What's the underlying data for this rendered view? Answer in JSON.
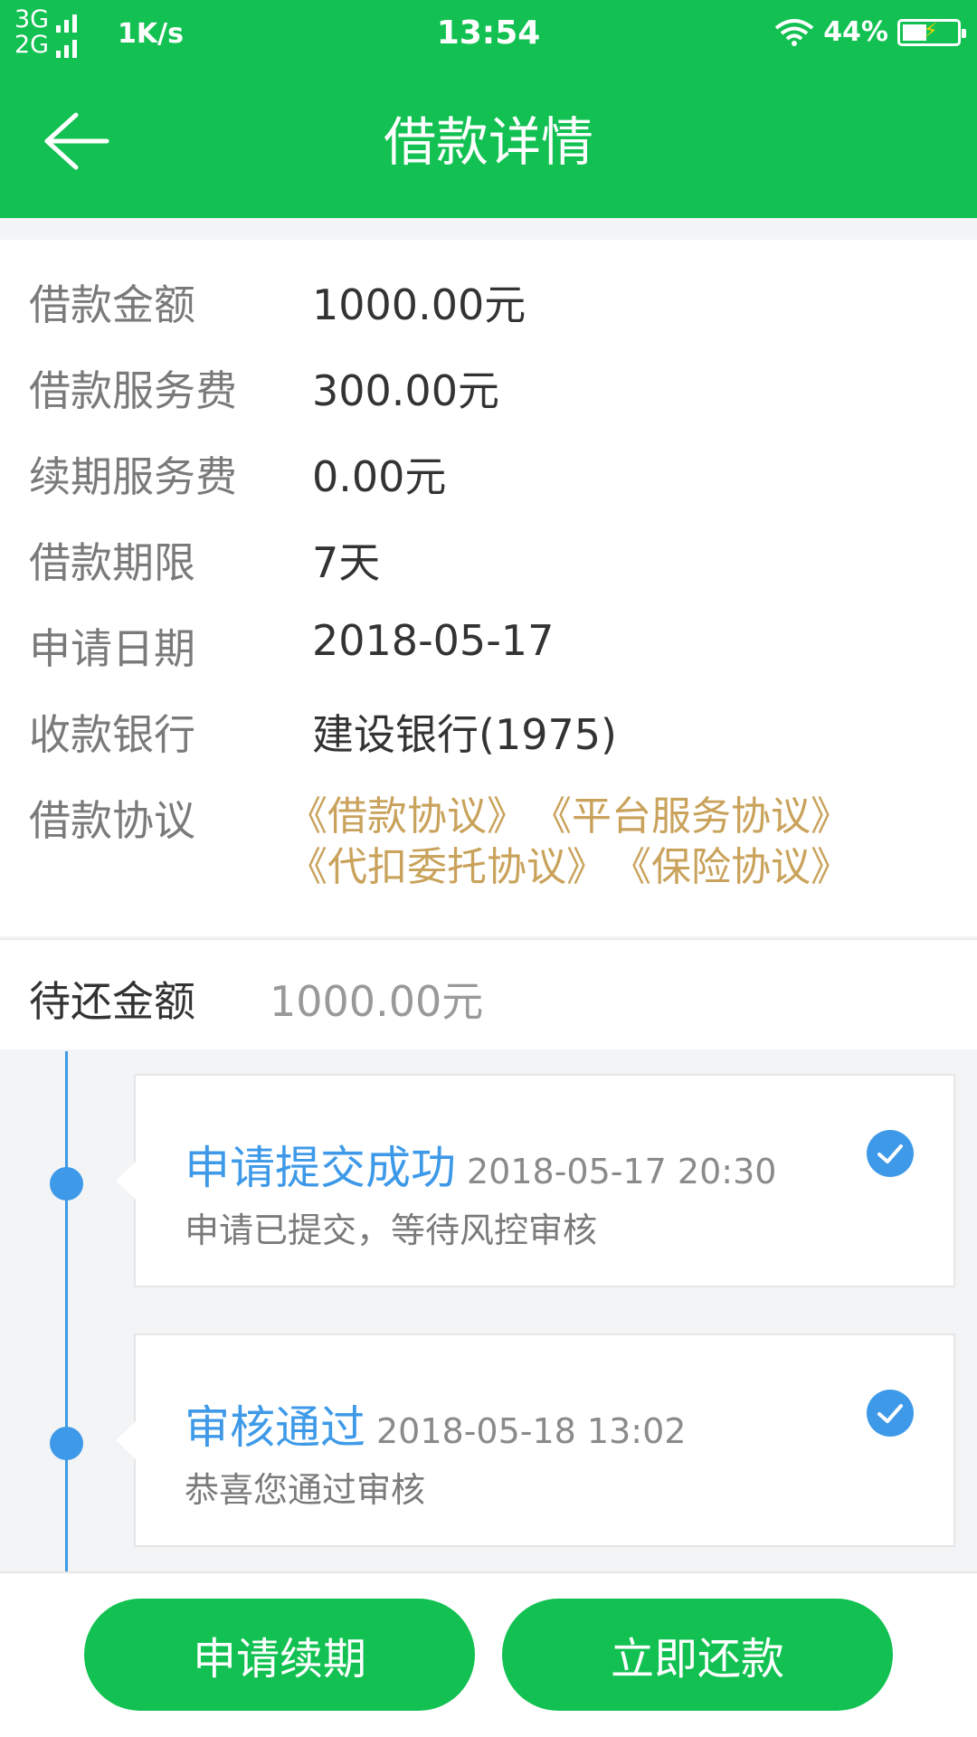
{
  "status_bar": {
    "net1": "3G",
    "net2": "2G",
    "speed": "1K/s",
    "time": "13:54",
    "battery": "44%",
    "battery_level": 0.44
  },
  "header": {
    "title": "借款详情",
    "back_icon": "arrow-left-icon"
  },
  "details": [
    {
      "label": "借款金额",
      "value": "1000.00元"
    },
    {
      "label": "借款服务费",
      "value": "300.00元"
    },
    {
      "label": "续期服务费",
      "value": "0.00元"
    },
    {
      "label": "借款期限",
      "value": "7天"
    },
    {
      "label": "申请日期",
      "value": "2018-05-17"
    },
    {
      "label": "收款银行",
      "value": "建设银行(1975)"
    }
  ],
  "agreements": {
    "label": "借款协议",
    "links": [
      "《借款协议》",
      "《平台服务协议》",
      "《代扣委托协议》",
      "《保险协议》"
    ]
  },
  "pending": {
    "label": "待还金额",
    "value": "1000.00元"
  },
  "timeline": [
    {
      "title": "申请提交成功",
      "time": "2018-05-17 20:30",
      "desc": "申请已提交，等待风控审核",
      "icon": "check-circle-icon"
    },
    {
      "title": "审核通过",
      "time": "2018-05-18 13:02",
      "desc": "恭喜您通过审核",
      "icon": "check-circle-icon"
    }
  ],
  "actions": {
    "renew": "申请续期",
    "repay": "立即还款"
  },
  "colors": {
    "primary_green": "#12c152",
    "timeline_blue": "#3e9ae8",
    "link_gold": "#c9a25b"
  }
}
